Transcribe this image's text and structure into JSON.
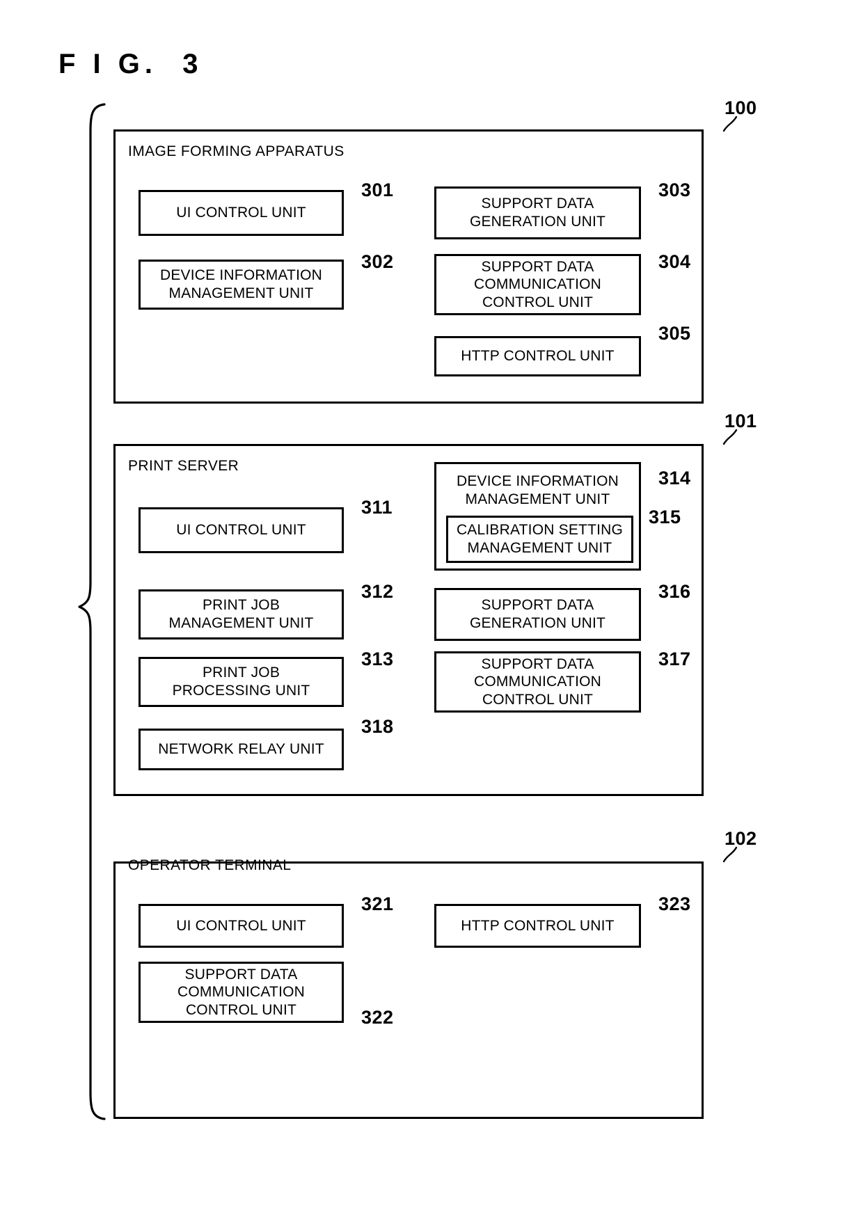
{
  "figure": {
    "title": "F I G.  3"
  },
  "groups": [
    {
      "id": "image-forming-apparatus",
      "title": "IMAGE FORMING APPARATUS",
      "ref": "100",
      "units": [
        {
          "id": "ui-control-unit-301",
          "label": "UI CONTROL UNIT",
          "ref": "301"
        },
        {
          "id": "device-info-mgmt-unit-302",
          "label": "DEVICE INFORMATION\nMANAGEMENT UNIT",
          "ref": "302"
        },
        {
          "id": "support-data-gen-unit-303",
          "label": "SUPPORT DATA\nGENERATION UNIT",
          "ref": "303"
        },
        {
          "id": "support-data-comm-303-304",
          "label": "SUPPORT DATA\nCOMMUNICATION\nCONTROL UNIT",
          "ref": "304"
        },
        {
          "id": "http-control-unit-305",
          "label": "HTTP CONTROL UNIT",
          "ref": "305"
        }
      ]
    },
    {
      "id": "print-server",
      "title": "PRINT SERVER",
      "ref": "101",
      "units": [
        {
          "id": "ui-control-unit-311",
          "label": "UI CONTROL UNIT",
          "ref": "311"
        },
        {
          "id": "print-job-mgmt-unit-312",
          "label": "PRINT JOB\nMANAGEMENT UNIT",
          "ref": "312"
        },
        {
          "id": "print-job-proc-unit-313",
          "label": "PRINT JOB\nPROCESSING UNIT",
          "ref": "313"
        },
        {
          "id": "device-info-mgmt-unit-314",
          "label": "DEVICE INFORMATION\nMANAGEMENT UNIT",
          "ref": "314"
        },
        {
          "id": "calib-setting-mgmt-315",
          "label": "CALIBRATION SETTING\nMANAGEMENT UNIT",
          "ref": "315"
        },
        {
          "id": "support-data-gen-unit-316",
          "label": "SUPPORT DATA\nGENERATION UNIT",
          "ref": "316"
        },
        {
          "id": "support-data-comm-317",
          "label": "SUPPORT DATA\nCOMMUNICATION\nCONTROL UNIT",
          "ref": "317"
        },
        {
          "id": "network-relay-unit-318",
          "label": "NETWORK RELAY UNIT",
          "ref": "318"
        }
      ]
    },
    {
      "id": "operator-terminal",
      "title": "OPERATOR TERMINAL",
      "ref": "102",
      "units": [
        {
          "id": "ui-control-unit-321",
          "label": "UI CONTROL UNIT",
          "ref": "321"
        },
        {
          "id": "support-data-comm-322",
          "label": "SUPPORT DATA\nCOMMUNICATION\nCONTROL UNIT",
          "ref": "322"
        },
        {
          "id": "http-control-unit-323",
          "label": "HTTP CONTROL UNIT",
          "ref": "323"
        }
      ]
    }
  ]
}
